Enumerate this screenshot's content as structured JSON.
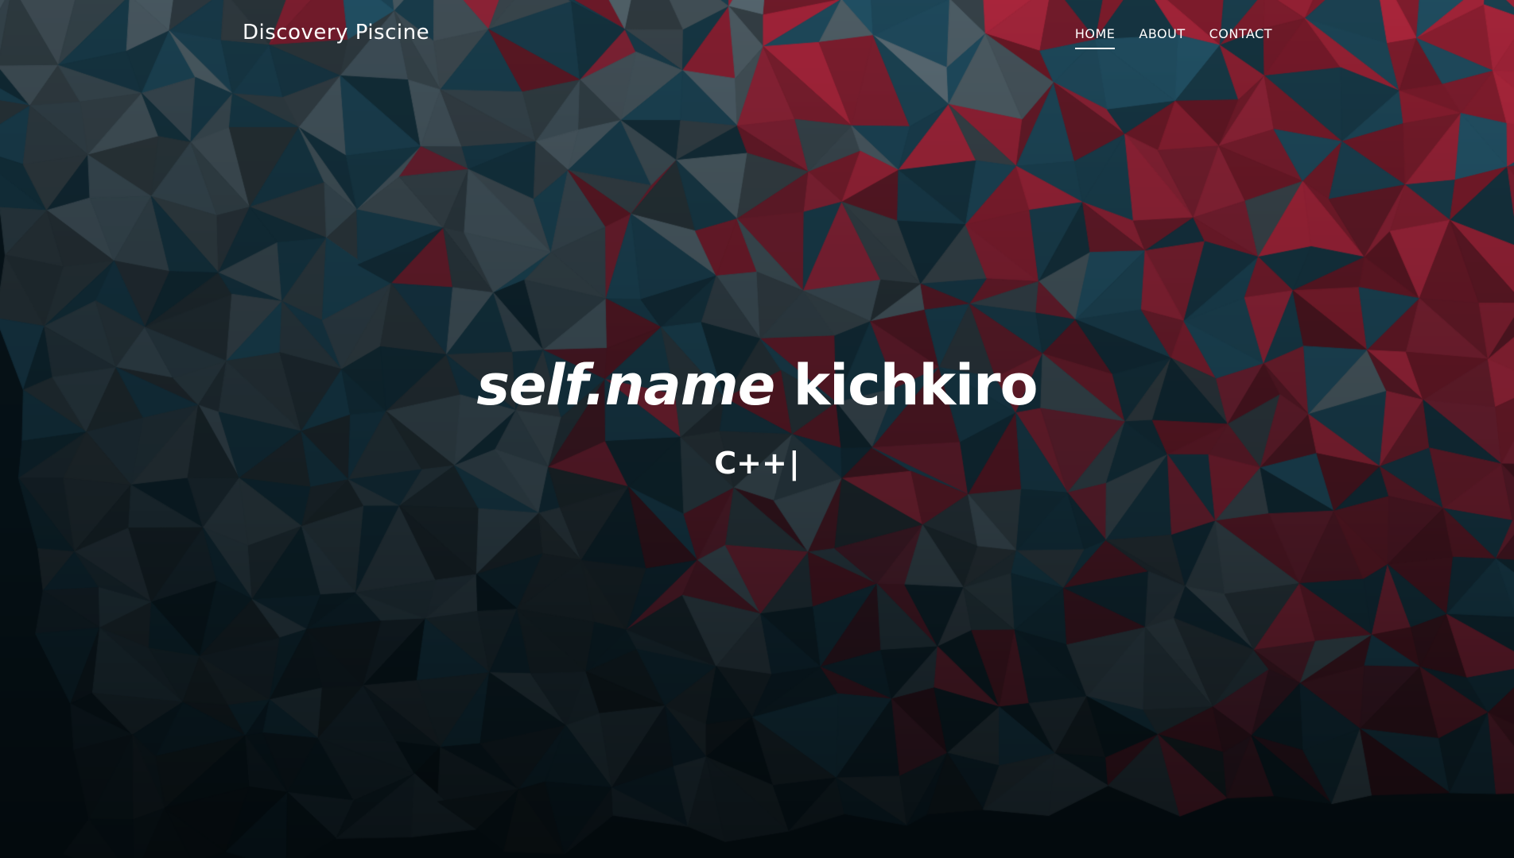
{
  "navbar": {
    "brand": "Discovery Piscine",
    "links": [
      {
        "label": "HOME",
        "active": true
      },
      {
        "label": "ABOUT",
        "active": false
      },
      {
        "label": "CONTACT",
        "active": false
      }
    ]
  },
  "hero": {
    "headline_code": "self.name",
    "headline_name": "kichkiro",
    "typed_text": "C++",
    "cursor": "|"
  },
  "colors": {
    "text": "#ffffff",
    "bg_dark": "#07151c",
    "bg_teal": "#1f4a5c",
    "bg_red": "#9a2236",
    "bg_grey": "#4f5e66"
  }
}
